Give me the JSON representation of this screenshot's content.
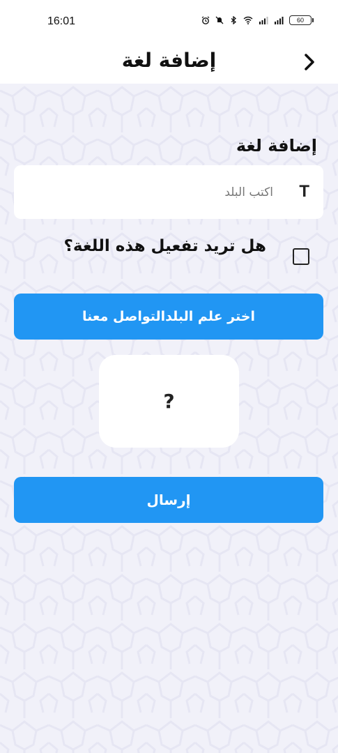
{
  "status_bar": {
    "time": "16:01",
    "battery": "60",
    "icons": [
      "alarm-icon",
      "mute-icon",
      "bluetooth-icon",
      "wifi-icon",
      "signal-icon",
      "signal-icon",
      "battery-icon"
    ]
  },
  "header": {
    "title": "إضافة لغة",
    "back_icon": "chevron-right-icon"
  },
  "form": {
    "section_title": "إضافة لغة",
    "country_field": {
      "placeholder": "اكتب البلد",
      "value": "",
      "icon": "T"
    },
    "activate": {
      "label": "هل تريد تفعيل هذه اللغة؟",
      "checked": false
    },
    "flag_button_label": "اختر علم البلدالتواصل معنا",
    "flag_preview": "?",
    "submit_label": "إرسال"
  },
  "colors": {
    "primary": "#2196f3",
    "background": "#f1f1f9",
    "surface": "#ffffff"
  }
}
